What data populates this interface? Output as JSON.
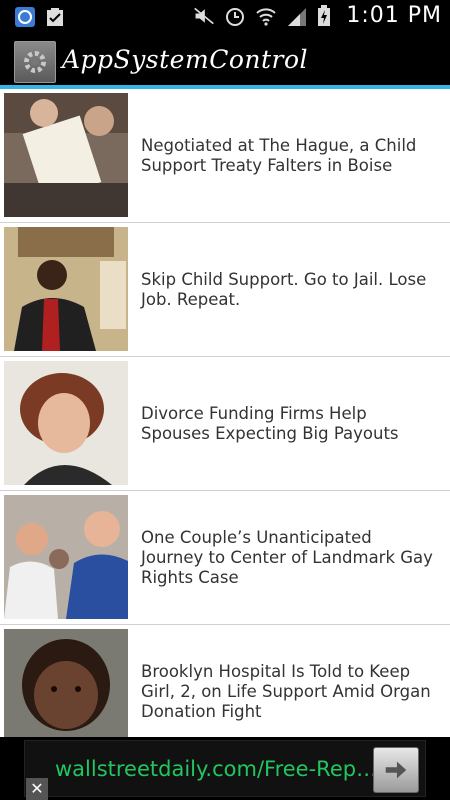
{
  "status_bar": {
    "time": "1:01 PM",
    "icons": [
      "app-notification-icon",
      "clipboard-check-icon",
      "mute-icon",
      "alarm-icon",
      "wifi-icon",
      "signal-icon",
      "battery-charging-icon"
    ]
  },
  "action_bar": {
    "title": "AppSystemControl",
    "icon": "gear-icon"
  },
  "articles": [
    {
      "headline": "Negotiated at The Hague, a Child Support Treaty Falters in Boise"
    },
    {
      "headline": "Skip Child Support. Go to Jail. Lose Job. Repeat."
    },
    {
      "headline": "Divorce Funding Firms Help Spouses Expecting Big Payouts"
    },
    {
      "headline": "One Couple’s Unanticipated Journey to Center of Landmark Gay Rights Case"
    },
    {
      "headline": "Brooklyn Hospital Is Told to Keep Girl, 2, on Life Support Amid Organ Donation Fight"
    }
  ],
  "ad": {
    "text": "wallstreetdaily.com/Free-Rep…",
    "action_icon": "arrow-right-icon",
    "close_label": "✕"
  },
  "colors": {
    "accent": "#33b5e5",
    "ad_text": "#22c55e"
  }
}
